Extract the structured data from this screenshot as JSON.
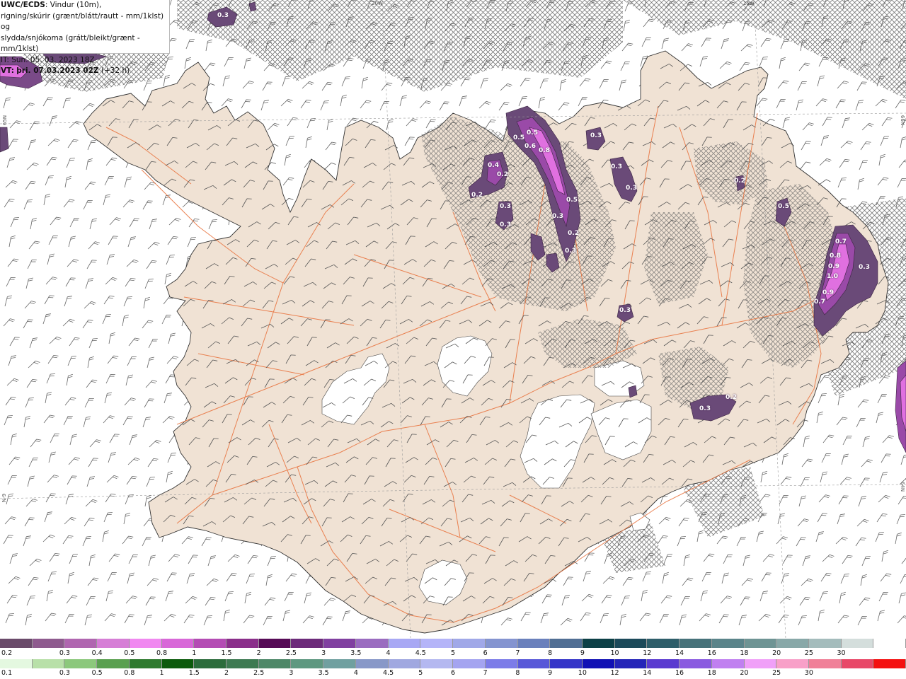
{
  "info": {
    "model": "UWC/ECDS",
    "line1_suffix": ": Vindur (10m),",
    "line2": "rigning/skúrir (grænt/blátt/rautt - mm/1klst) og",
    "line3": "slydda/snjókoma (grátt/bleikt/grænt - mm/1klst)",
    "init": "IT: Sun. 05. 03. 2023 18Z",
    "valid_label": "VT:",
    "valid_time": "þri. 07.03.2023 02Z",
    "lead": "(+32 h)"
  },
  "graticule_labels": {
    "lon_20w": "20W",
    "lon_15w": "15W",
    "lat_left_top": "65N",
    "lat_left_bottom": "N-9",
    "lat_right_top": "66N",
    "lat_right_bottom": "64N"
  },
  "colors": {
    "land": "#f0e2d4",
    "roads": "#e8703a",
    "coast": "#333333",
    "glacier": "#ffffff",
    "wind_barb": "#555555",
    "sleet_hatch": "#6a6a6a",
    "precip_low": "#6a4a78",
    "precip_mid": "#9a4aa8",
    "precip_high": "#e070e0"
  },
  "precip_labels": [
    "0.3",
    "0.5",
    "0.5",
    "0.6",
    "0.8",
    "0.3",
    "0.3",
    "0.3",
    "0.4",
    "0.2",
    "0.2",
    "0.3",
    "0.3",
    "0.5",
    "0.3",
    "0.2",
    "0.3",
    "0.2",
    "0.5",
    "0.7",
    "0.8",
    "0.9",
    "1.0",
    "0.9",
    "0.7",
    "0.3",
    "0.3",
    "0.3",
    "0.2"
  ],
  "legend_snow": {
    "colors": [
      "#6a4a6a",
      "#8e5a8e",
      "#b066b0",
      "#d67ed6",
      "#f088f0",
      "#d868d8",
      "#b44cb4",
      "#8a2e8a",
      "#560a56",
      "#6c2a7a",
      "#8040a0",
      "#9a6cc0",
      "#a8a8f4",
      "#b4b4f8",
      "#a0a8e8",
      "#8494d0",
      "#6a80bc",
      "#506e94",
      "#0c4046",
      "#1c4a5a",
      "#2e5e6a",
      "#46727a",
      "#5a848a",
      "#6e9494",
      "#88a8a8",
      "#a4bcbc",
      "#d4dedc",
      "#ffffff"
    ],
    "labels": [
      "0.2",
      "0.3",
      "0.4",
      "0.5",
      "0.8",
      "1",
      "1.5",
      "2",
      "2.5",
      "3",
      "3.5",
      "4",
      "4.5",
      "5",
      "6",
      "7",
      "8",
      "9",
      "10",
      "12",
      "14",
      "16",
      "18",
      "20",
      "25",
      "30"
    ]
  },
  "legend_rain": {
    "colors": [
      "#e4f8e0",
      "#b8e0a8",
      "#8cc87c",
      "#5aa050",
      "#2e7a2e",
      "#0c5a0c",
      "#2c6c3c",
      "#3e7a52",
      "#4e8868",
      "#5e9880",
      "#70a0a0",
      "#8898c8",
      "#a0a8e0",
      "#b4b8f0",
      "#a4a4f0",
      "#7c7ce8",
      "#5858d8",
      "#3434c8",
      "#1010b4",
      "#2424b8",
      "#5a3ad0",
      "#8a5ae0",
      "#c080f0",
      "#f0a0f8",
      "#f8a0c8",
      "#f08098",
      "#e84868",
      "#f41010"
    ],
    "labels": [
      "0.1",
      "0.3",
      "0.5",
      "0.8",
      "1",
      "1.5",
      "2",
      "2.5",
      "3",
      "3.5",
      "4",
      "4.5",
      "5",
      "6",
      "7",
      "8",
      "9",
      "10",
      "12",
      "14",
      "16",
      "18",
      "20",
      "25",
      "30"
    ]
  }
}
